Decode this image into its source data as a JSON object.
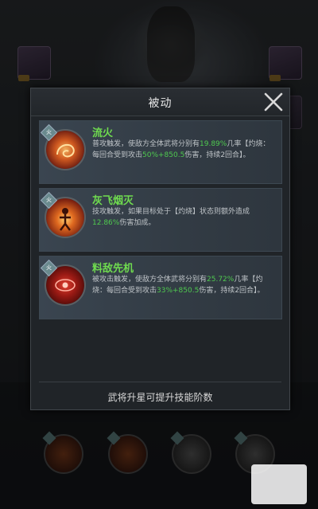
{
  "modal": {
    "title": "被动",
    "footer": "武将升星可提升技能阶数"
  },
  "skills": [
    {
      "name": "流火",
      "icon": "fire-swirl-icon",
      "badge": "火",
      "desc_1": "普攻触发，使敌方全体武将分别有",
      "desc_2": "19.89%",
      "desc_3": "几率【灼烧：每回合受到攻击",
      "desc_4": "50%+850.5",
      "desc_5": "伤害，持续2回合】。"
    },
    {
      "name": "灰飞烟灭",
      "icon": "flame-figure-icon",
      "badge": "火",
      "desc_1": "技攻触发，如果目标处于【灼烧】状态则额外造成",
      "desc_2": "12.86%",
      "desc_3": "伤害加成。"
    },
    {
      "name": "料敌先机",
      "icon": "red-eye-icon",
      "badge": "火",
      "desc_1": "被攻击触发，使敌方全体武将分别有",
      "desc_2": "25.72%",
      "desc_3": "几率【灼烧：每回合受到攻击",
      "desc_4": "33%+850.5",
      "desc_5": "伤害，持续2回合】。"
    }
  ],
  "colors": {
    "skill_name": "#6fdb4f",
    "highlight": "#4fc94f",
    "panel_bg": "#202428"
  }
}
